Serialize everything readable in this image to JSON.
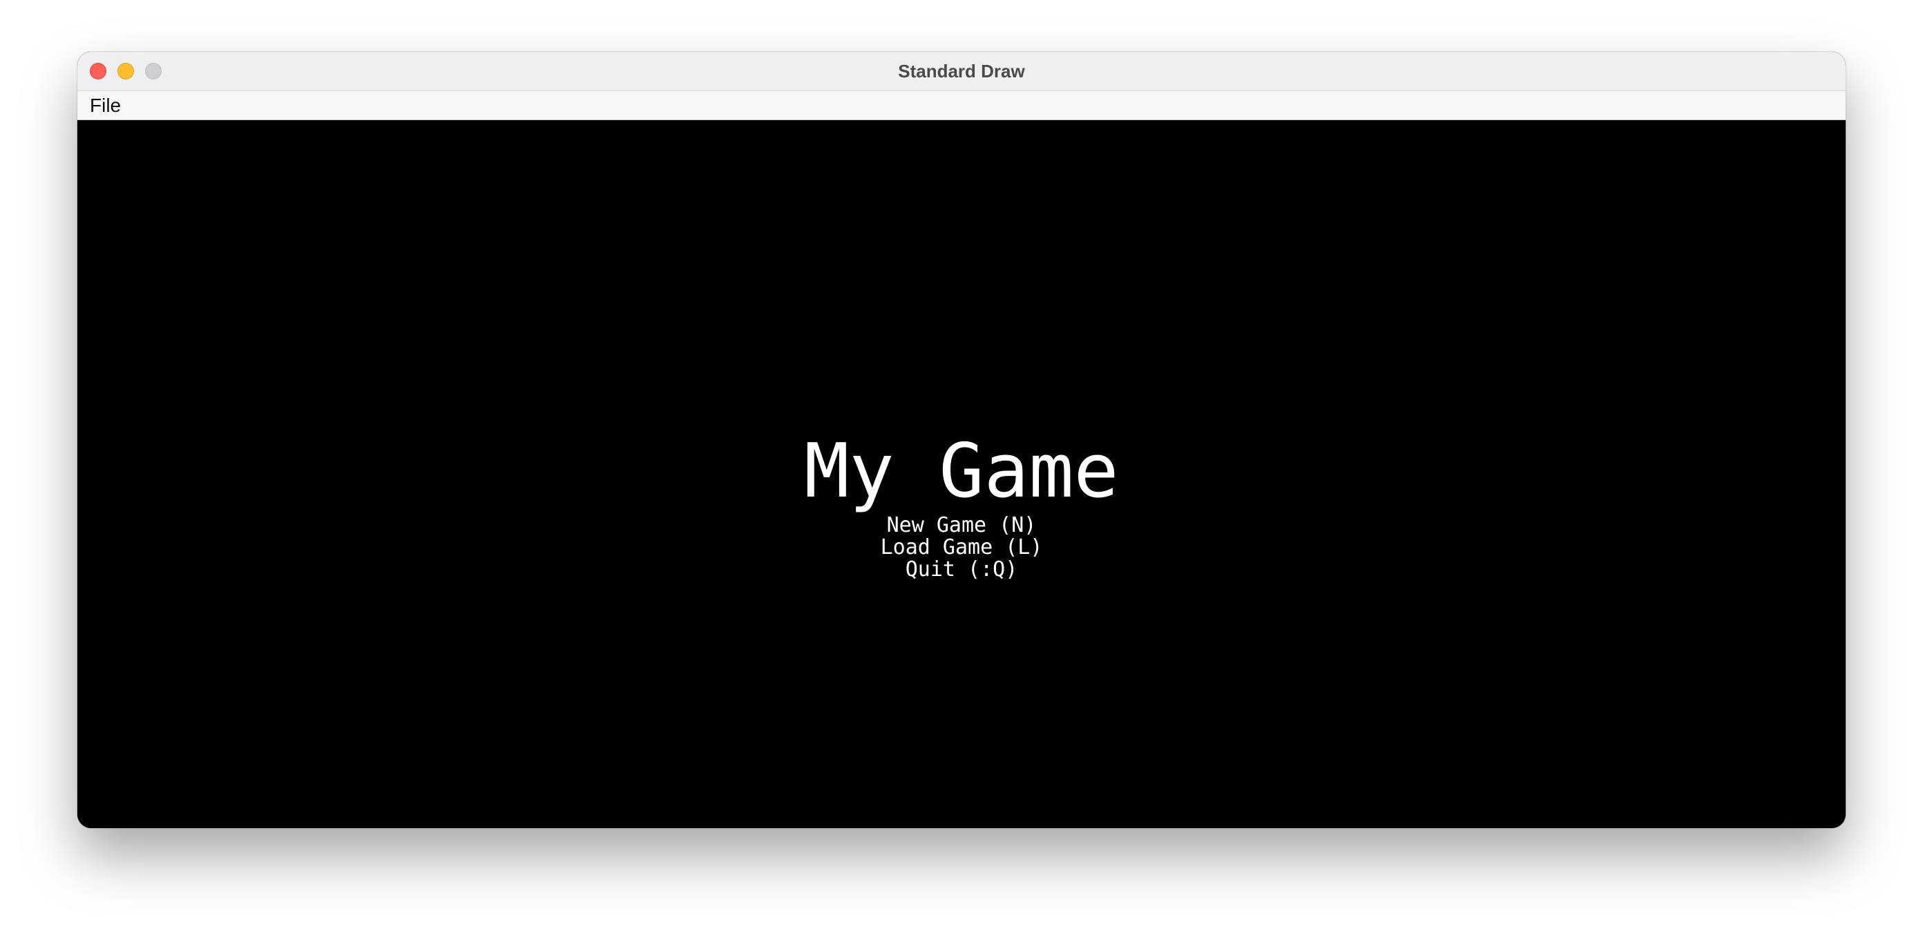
{
  "window": {
    "title": "Standard Draw"
  },
  "menubar": {
    "items": [
      {
        "label": "File"
      }
    ]
  },
  "game": {
    "title": "My Game",
    "options": [
      {
        "label": "New Game (N)"
      },
      {
        "label": "Load Game (L)"
      },
      {
        "label": "Quit (:Q)"
      }
    ]
  },
  "colors": {
    "canvas_background": "#000000",
    "text": "#ffffff",
    "close": "#ff5f57",
    "minimize": "#febc2e",
    "zoom_disabled": "#cfcfd1"
  }
}
